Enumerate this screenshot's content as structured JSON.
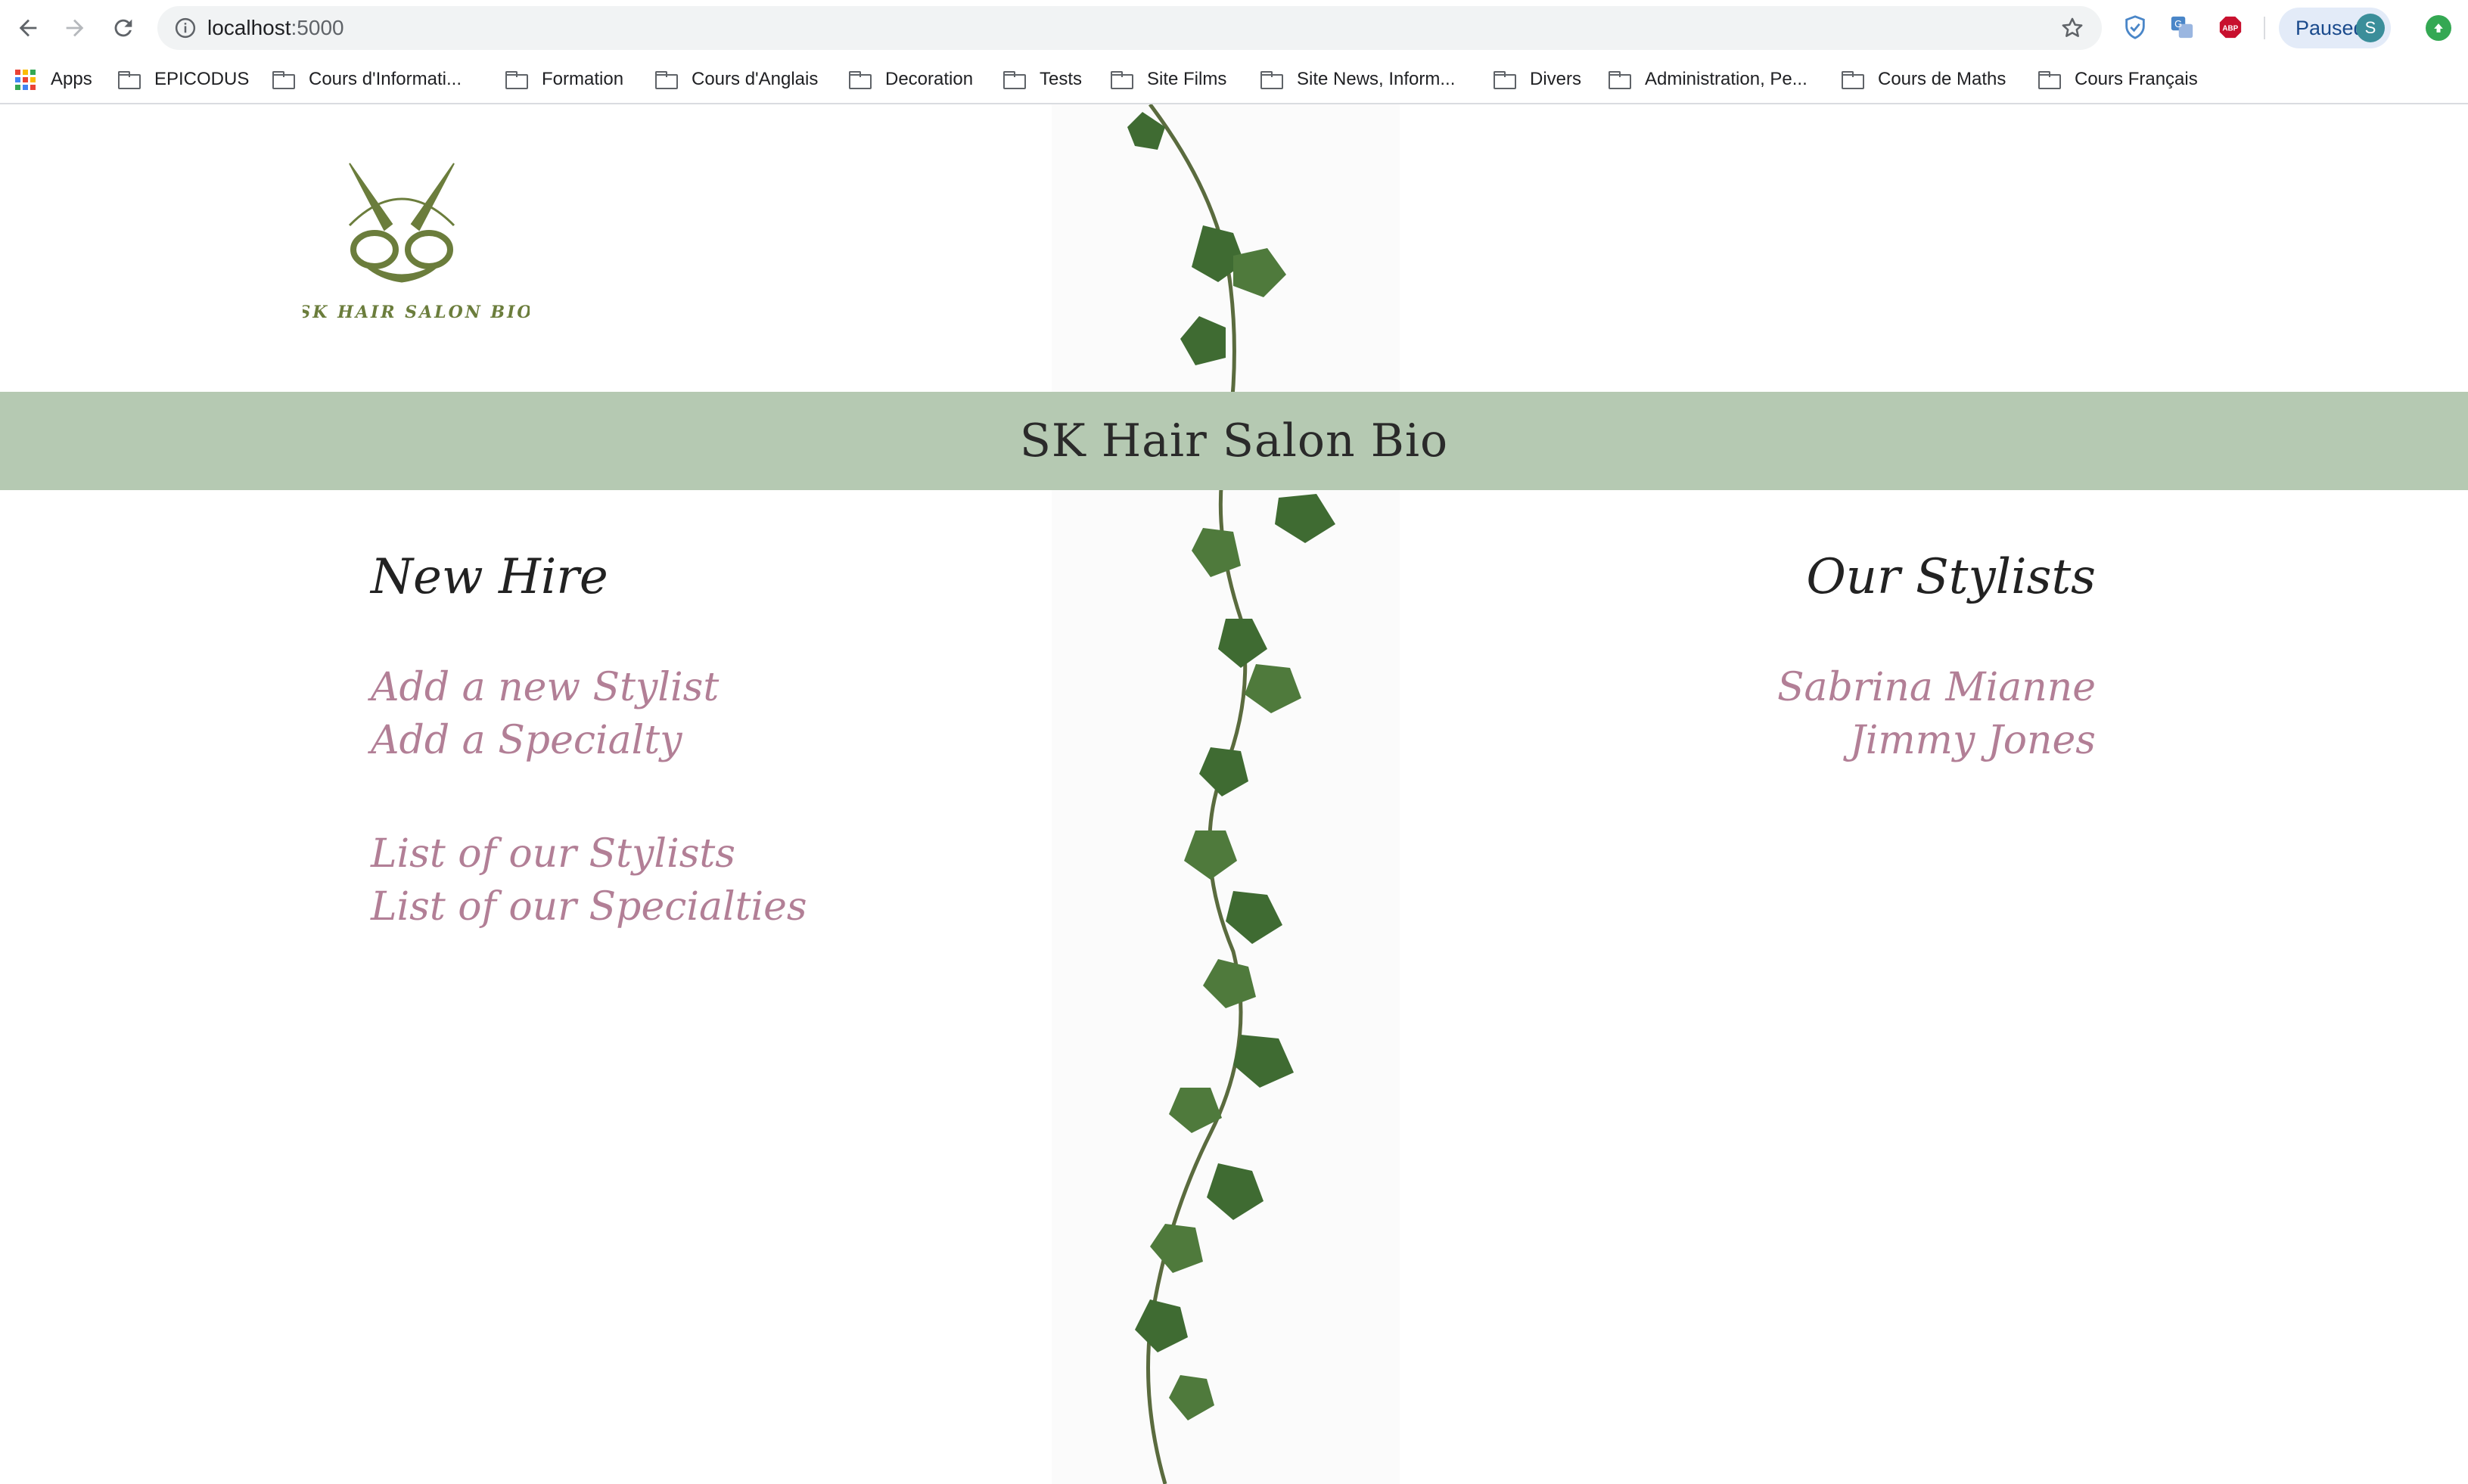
{
  "browser": {
    "url_host": "localhost",
    "url_port": ":5000",
    "profile_label": "Paused",
    "profile_initial": "S",
    "bookmarks": {
      "apps": "Apps",
      "items": [
        "EPICODUS",
        "Cours d'Informati...",
        "Formation",
        "Cours d'Anglais",
        "Decoration",
        "Tests",
        "Site Films",
        "Site News, Inform...",
        "Divers",
        "Administration, Pe...",
        "Cours de Maths",
        "Cours Français"
      ],
      "more": "»"
    }
  },
  "page": {
    "logo_text": "SK HAIR SALON BIO",
    "banner_title": "SK Hair Salon Bio",
    "new_hire": {
      "heading": "New Hire",
      "links": [
        "Add a new Stylist",
        "Add a Specialty",
        "List of our Stylists",
        "List of our Specialties"
      ]
    },
    "stylists": {
      "heading": "Our Stylists",
      "names": [
        "Sabrina Mianne",
        "Jimmy Jones"
      ]
    }
  },
  "colors": {
    "banner_bg": "#b5c9b2",
    "link": "#b27f96",
    "logo_green": "#6b7d3c"
  }
}
